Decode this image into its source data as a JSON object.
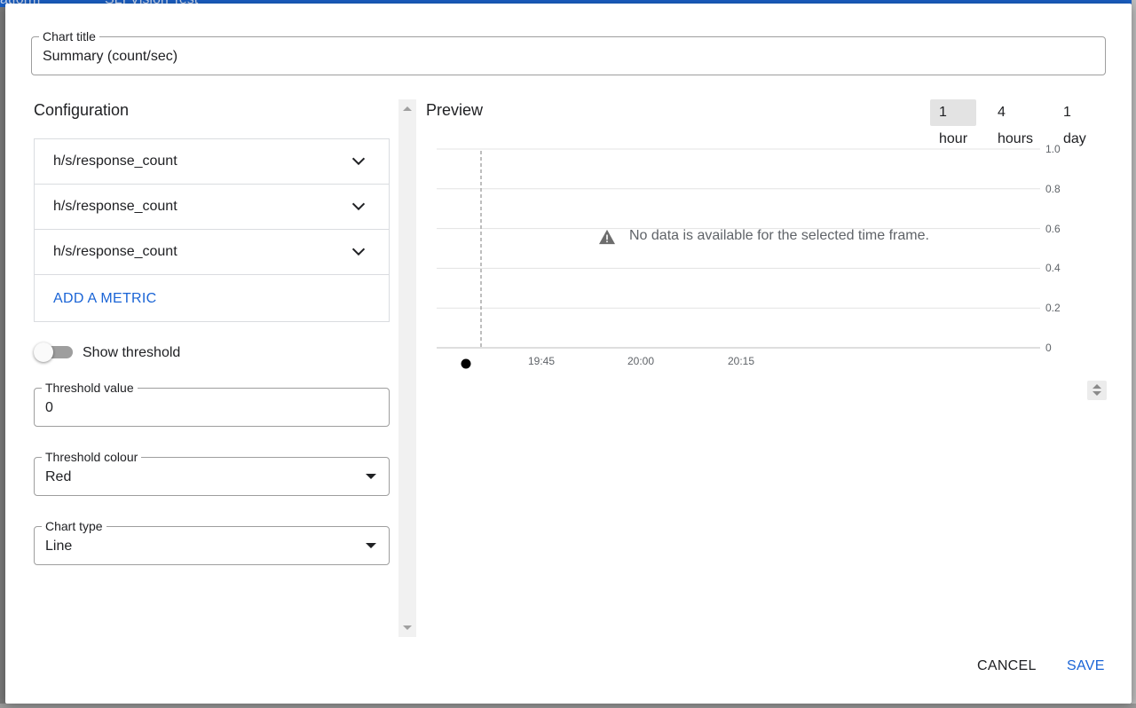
{
  "background": {
    "header_text_1": "atform",
    "header_text_2": "SLI Vision Test"
  },
  "dialog": {
    "chart_title": {
      "label": "Chart title",
      "value": "Summary (count/sec)"
    },
    "configuration": {
      "title": "Configuration",
      "metrics": [
        {
          "label": "h/s/response_count"
        },
        {
          "label": "h/s/response_count"
        },
        {
          "label": "h/s/response_count"
        }
      ],
      "add_metric_label": "ADD A METRIC",
      "show_threshold": {
        "label": "Show threshold",
        "enabled": false
      },
      "threshold_value": {
        "label": "Threshold value",
        "value": "0"
      },
      "threshold_colour": {
        "label": "Threshold colour",
        "value": "Red"
      },
      "chart_type": {
        "label": "Chart type",
        "value": "Line"
      }
    },
    "preview": {
      "title": "Preview",
      "time_ranges": [
        {
          "label": "1 hour",
          "active": true
        },
        {
          "label": "4 hours",
          "active": false
        },
        {
          "label": "1 day",
          "active": false
        }
      ],
      "no_data_message": "No data is available for the selected time frame."
    },
    "actions": {
      "cancel_label": "CANCEL",
      "save_label": "SAVE"
    }
  },
  "colors": {
    "accent": "#1a64d6",
    "active_tab_bg": "#e3e3e3",
    "text": "#202124",
    "secondary_text": "#5f6368"
  },
  "icons": {
    "metric_expand": "chevron-down-icon",
    "no_data": "warning-icon",
    "dropdown": "arrow-drop-down-icon"
  },
  "chart_data": {
    "type": "line",
    "series": [],
    "x_ticks": [
      "19:45",
      "20:00",
      "20:15"
    ],
    "y_ticks": [
      "1.0",
      "0.8",
      "0.6",
      "0.4",
      "0.2",
      "0"
    ],
    "ylim": [
      0,
      1.0
    ],
    "grid": true,
    "y_axis_side": "right",
    "has_now_marker": true
  }
}
